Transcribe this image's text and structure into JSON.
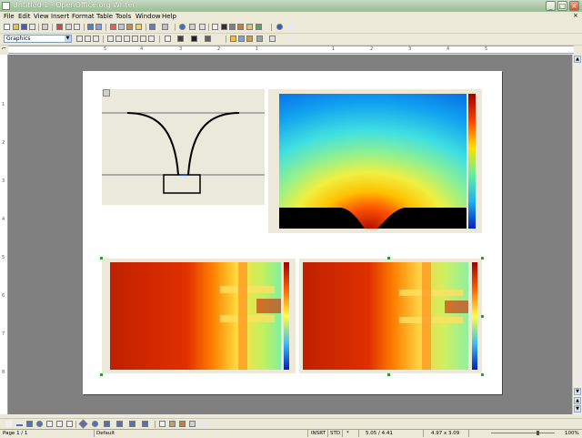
{
  "window": {
    "title": "Untitled 1 - OpenOffice.org Writer",
    "minimize": "_",
    "maximize": "□",
    "close": "×"
  },
  "menu": [
    {
      "label": "File"
    },
    {
      "label": "Edit"
    },
    {
      "label": "View"
    },
    {
      "label": "Insert"
    },
    {
      "label": "Format"
    },
    {
      "label": "Table"
    },
    {
      "label": "Tools"
    },
    {
      "label": "Window"
    },
    {
      "label": "Help"
    }
  ],
  "formatting": {
    "style_value": "Graphics"
  },
  "ruler": {
    "h_numbers": [
      "5",
      "4",
      "3",
      "2",
      "1",
      "1",
      "2",
      "3",
      "4",
      "5"
    ],
    "v_numbers": [
      "1",
      "2",
      "3",
      "4",
      "5",
      "6",
      "7",
      "8"
    ]
  },
  "status": {
    "page": "Page 1 / 1",
    "style": "Default",
    "insert_mode": "INSRT",
    "selection_mode": "STD",
    "modified": "*",
    "position": "5.05 / 4.41",
    "size": "4.97 x 3.09",
    "zoom": "100%"
  },
  "colors": {
    "accent": "#2e9a2e",
    "workspace": "#808080"
  }
}
